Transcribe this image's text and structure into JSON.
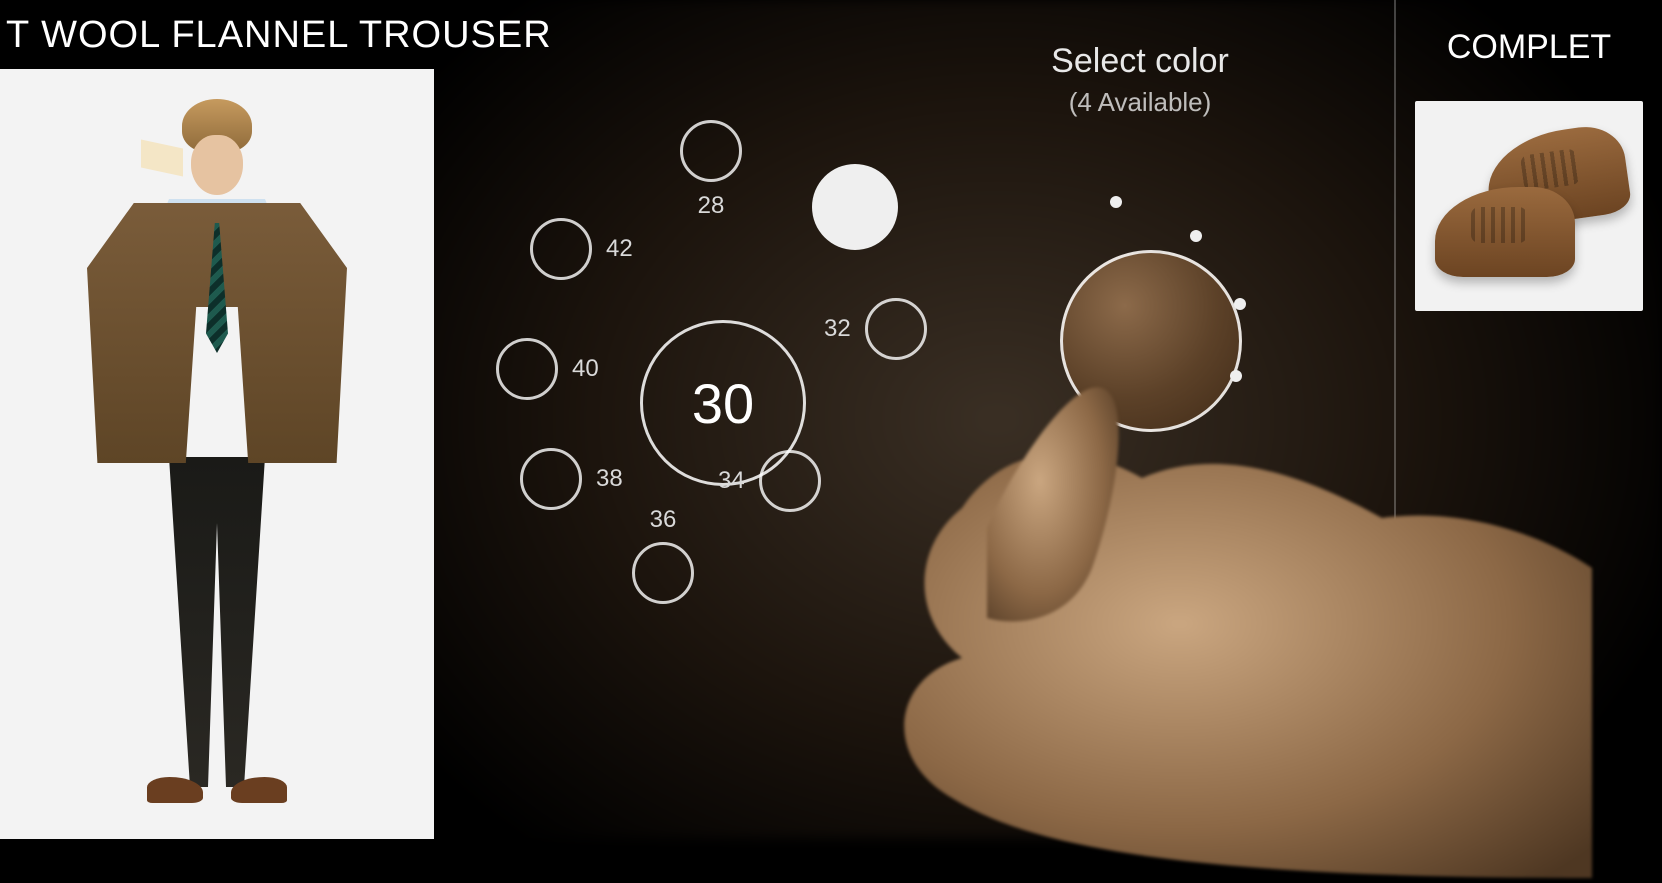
{
  "product": {
    "title": "T WOOL FLANNEL TROUSER"
  },
  "sizes": {
    "selected": "30",
    "options": [
      "28",
      "32",
      "34",
      "36",
      "38",
      "40",
      "42"
    ]
  },
  "color": {
    "heading": "Select color",
    "availability": "(4 Available)",
    "swatches": [
      {
        "name": "white",
        "hex": "#f2f2f2",
        "selected": false
      },
      {
        "name": "brown",
        "hex": "#6a4a2d",
        "selected": true
      }
    ]
  },
  "rightColumn": {
    "heading": "COMPLET"
  }
}
